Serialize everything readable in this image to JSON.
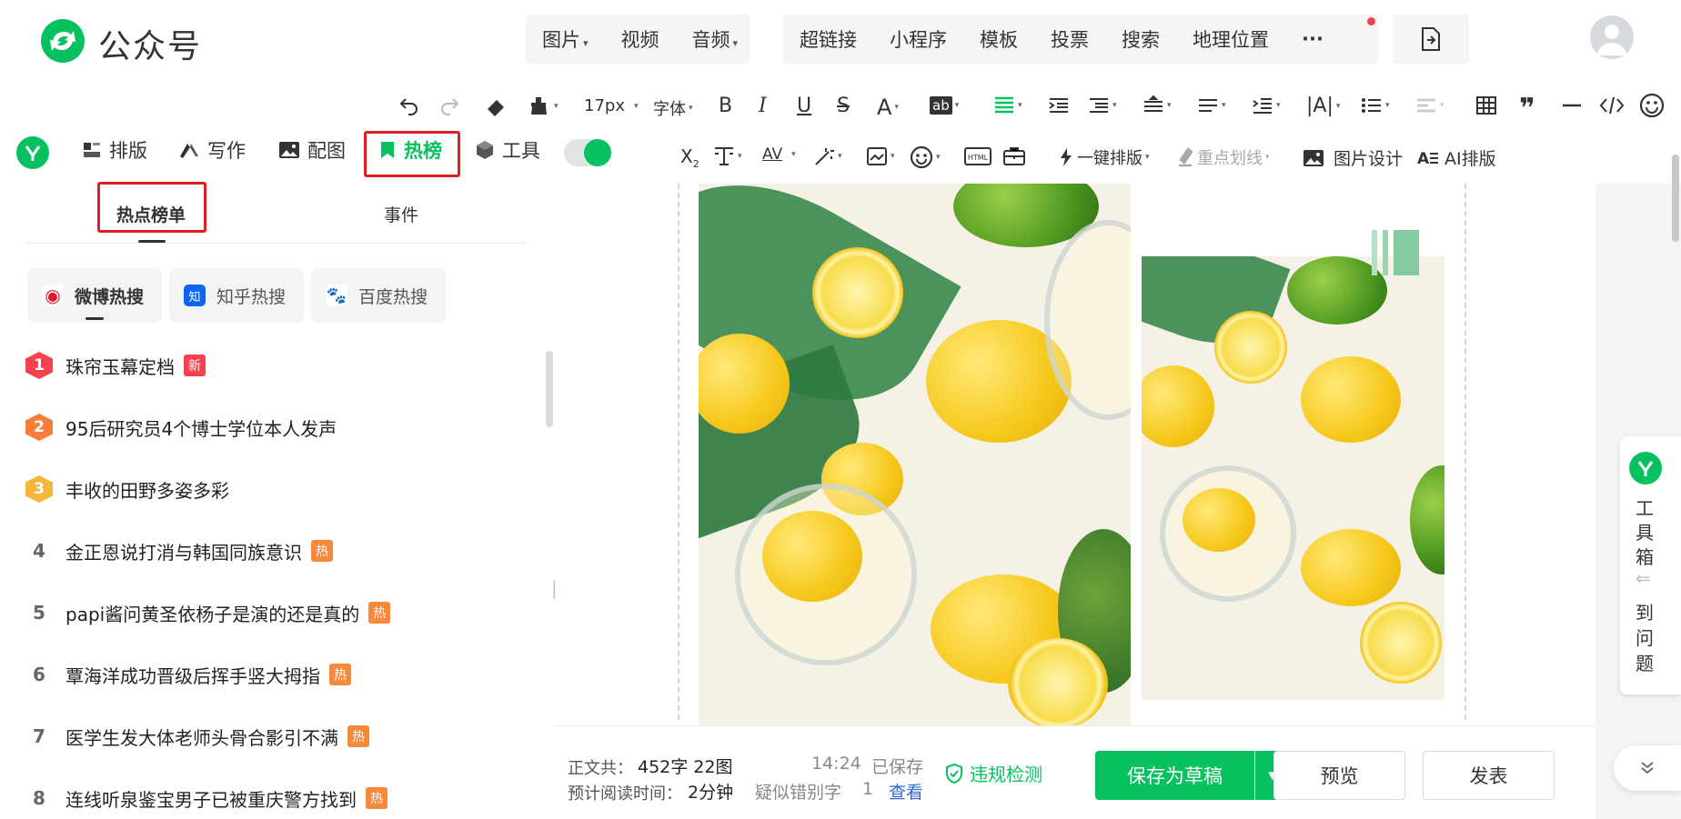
{
  "header": {
    "brand": "公众号",
    "group1": [
      {
        "label": "图片",
        "caret": "▾"
      },
      {
        "label": "视频",
        "caret": ""
      },
      {
        "label": "音频",
        "caret": "▾"
      }
    ],
    "group2": [
      "超链接",
      "小程序",
      "模板",
      "投票",
      "搜索",
      "地理位置"
    ],
    "more": "···"
  },
  "toolbar": {
    "font_size": "17px",
    "font_family": "字体",
    "row2": {
      "one_click": "一键排版",
      "highlight": "重点划线",
      "image_design": "图片设计",
      "ai_layout": "AI排版"
    }
  },
  "plugin_tabs": [
    {
      "label": "排版"
    },
    {
      "label": "写作"
    },
    {
      "label": "配图"
    },
    {
      "label": "热榜"
    },
    {
      "label": "工具"
    }
  ],
  "hot": {
    "tabs": [
      "热点榜单",
      "事件"
    ],
    "sources": [
      "微博热搜",
      "知乎热搜",
      "百度热搜"
    ],
    "items": [
      {
        "rank": "1",
        "title": "珠帘玉幕定档",
        "tag": "新",
        "tag_type": "new"
      },
      {
        "rank": "2",
        "title": "95后研究员4个博士学位本人发声",
        "tag": "",
        "tag_type": ""
      },
      {
        "rank": "3",
        "title": "丰收的田野多姿多彩",
        "tag": "",
        "tag_type": ""
      },
      {
        "rank": "4",
        "title": "金正恩说打消与韩国同族意识",
        "tag": "热",
        "tag_type": "hot"
      },
      {
        "rank": "5",
        "title": "papi酱问黄圣依杨子是演的还是真的",
        "tag": "热",
        "tag_type": "hot"
      },
      {
        "rank": "6",
        "title": "覃海洋成功晋级后挥手竖大拇指",
        "tag": "热",
        "tag_type": "hot"
      },
      {
        "rank": "7",
        "title": "医学生发大体老师头骨合影引不满",
        "tag": "热",
        "tag_type": "hot"
      },
      {
        "rank": "8",
        "title": "连线听泉鉴宝男子已被重庆警方找到",
        "tag": "热",
        "tag_type": "hot"
      }
    ]
  },
  "footer": {
    "body_label": "正文共：",
    "body_count": "452字 22图",
    "read_label": "预计阅读时间：",
    "read_time": "2分钟",
    "save_time": "14:24",
    "saved": "已保存",
    "typo_label": "疑似错别字",
    "typo_count": "1",
    "check_link": "查看",
    "violation": "违规检测",
    "save_draft": "保存为草稿",
    "preview": "预览",
    "publish": "发表"
  },
  "float": {
    "toolbox": [
      "工",
      "具",
      "箱"
    ],
    "feedback": [
      "到",
      "问",
      "题"
    ]
  },
  "colors": {
    "accent": "#07c160",
    "highlight_box": "#e02020",
    "hot_tag": "#f7893a",
    "new_tag": "#f5424c"
  }
}
